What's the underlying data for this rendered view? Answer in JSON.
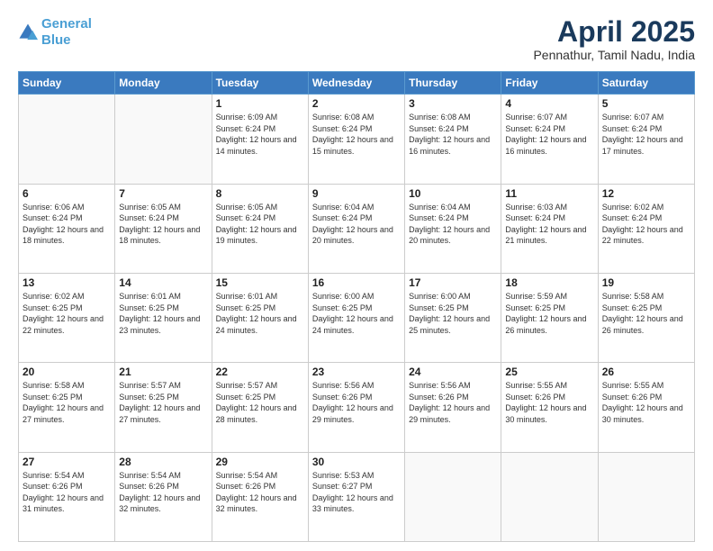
{
  "logo": {
    "line1": "General",
    "line2": "Blue"
  },
  "title": "April 2025",
  "subtitle": "Pennathur, Tamil Nadu, India",
  "days_header": [
    "Sunday",
    "Monday",
    "Tuesday",
    "Wednesday",
    "Thursday",
    "Friday",
    "Saturday"
  ],
  "weeks": [
    [
      {
        "day": "",
        "detail": ""
      },
      {
        "day": "",
        "detail": ""
      },
      {
        "day": "1",
        "detail": "Sunrise: 6:09 AM\nSunset: 6:24 PM\nDaylight: 12 hours and 14 minutes."
      },
      {
        "day": "2",
        "detail": "Sunrise: 6:08 AM\nSunset: 6:24 PM\nDaylight: 12 hours and 15 minutes."
      },
      {
        "day": "3",
        "detail": "Sunrise: 6:08 AM\nSunset: 6:24 PM\nDaylight: 12 hours and 16 minutes."
      },
      {
        "day": "4",
        "detail": "Sunrise: 6:07 AM\nSunset: 6:24 PM\nDaylight: 12 hours and 16 minutes."
      },
      {
        "day": "5",
        "detail": "Sunrise: 6:07 AM\nSunset: 6:24 PM\nDaylight: 12 hours and 17 minutes."
      }
    ],
    [
      {
        "day": "6",
        "detail": "Sunrise: 6:06 AM\nSunset: 6:24 PM\nDaylight: 12 hours and 18 minutes."
      },
      {
        "day": "7",
        "detail": "Sunrise: 6:05 AM\nSunset: 6:24 PM\nDaylight: 12 hours and 18 minutes."
      },
      {
        "day": "8",
        "detail": "Sunrise: 6:05 AM\nSunset: 6:24 PM\nDaylight: 12 hours and 19 minutes."
      },
      {
        "day": "9",
        "detail": "Sunrise: 6:04 AM\nSunset: 6:24 PM\nDaylight: 12 hours and 20 minutes."
      },
      {
        "day": "10",
        "detail": "Sunrise: 6:04 AM\nSunset: 6:24 PM\nDaylight: 12 hours and 20 minutes."
      },
      {
        "day": "11",
        "detail": "Sunrise: 6:03 AM\nSunset: 6:24 PM\nDaylight: 12 hours and 21 minutes."
      },
      {
        "day": "12",
        "detail": "Sunrise: 6:02 AM\nSunset: 6:24 PM\nDaylight: 12 hours and 22 minutes."
      }
    ],
    [
      {
        "day": "13",
        "detail": "Sunrise: 6:02 AM\nSunset: 6:25 PM\nDaylight: 12 hours and 22 minutes."
      },
      {
        "day": "14",
        "detail": "Sunrise: 6:01 AM\nSunset: 6:25 PM\nDaylight: 12 hours and 23 minutes."
      },
      {
        "day": "15",
        "detail": "Sunrise: 6:01 AM\nSunset: 6:25 PM\nDaylight: 12 hours and 24 minutes."
      },
      {
        "day": "16",
        "detail": "Sunrise: 6:00 AM\nSunset: 6:25 PM\nDaylight: 12 hours and 24 minutes."
      },
      {
        "day": "17",
        "detail": "Sunrise: 6:00 AM\nSunset: 6:25 PM\nDaylight: 12 hours and 25 minutes."
      },
      {
        "day": "18",
        "detail": "Sunrise: 5:59 AM\nSunset: 6:25 PM\nDaylight: 12 hours and 26 minutes."
      },
      {
        "day": "19",
        "detail": "Sunrise: 5:58 AM\nSunset: 6:25 PM\nDaylight: 12 hours and 26 minutes."
      }
    ],
    [
      {
        "day": "20",
        "detail": "Sunrise: 5:58 AM\nSunset: 6:25 PM\nDaylight: 12 hours and 27 minutes."
      },
      {
        "day": "21",
        "detail": "Sunrise: 5:57 AM\nSunset: 6:25 PM\nDaylight: 12 hours and 27 minutes."
      },
      {
        "day": "22",
        "detail": "Sunrise: 5:57 AM\nSunset: 6:25 PM\nDaylight: 12 hours and 28 minutes."
      },
      {
        "day": "23",
        "detail": "Sunrise: 5:56 AM\nSunset: 6:26 PM\nDaylight: 12 hours and 29 minutes."
      },
      {
        "day": "24",
        "detail": "Sunrise: 5:56 AM\nSunset: 6:26 PM\nDaylight: 12 hours and 29 minutes."
      },
      {
        "day": "25",
        "detail": "Sunrise: 5:55 AM\nSunset: 6:26 PM\nDaylight: 12 hours and 30 minutes."
      },
      {
        "day": "26",
        "detail": "Sunrise: 5:55 AM\nSunset: 6:26 PM\nDaylight: 12 hours and 30 minutes."
      }
    ],
    [
      {
        "day": "27",
        "detail": "Sunrise: 5:54 AM\nSunset: 6:26 PM\nDaylight: 12 hours and 31 minutes."
      },
      {
        "day": "28",
        "detail": "Sunrise: 5:54 AM\nSunset: 6:26 PM\nDaylight: 12 hours and 32 minutes."
      },
      {
        "day": "29",
        "detail": "Sunrise: 5:54 AM\nSunset: 6:26 PM\nDaylight: 12 hours and 32 minutes."
      },
      {
        "day": "30",
        "detail": "Sunrise: 5:53 AM\nSunset: 6:27 PM\nDaylight: 12 hours and 33 minutes."
      },
      {
        "day": "",
        "detail": ""
      },
      {
        "day": "",
        "detail": ""
      },
      {
        "day": "",
        "detail": ""
      }
    ]
  ]
}
